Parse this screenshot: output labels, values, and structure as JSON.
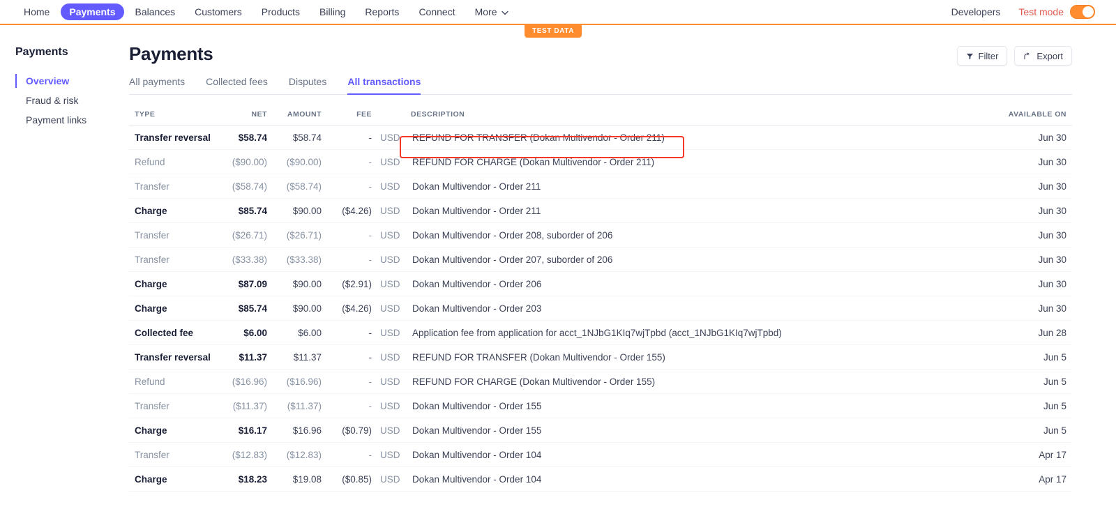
{
  "topnav": {
    "items": [
      {
        "label": "Home",
        "active": false
      },
      {
        "label": "Payments",
        "active": true
      },
      {
        "label": "Balances",
        "active": false
      },
      {
        "label": "Customers",
        "active": false
      },
      {
        "label": "Products",
        "active": false
      },
      {
        "label": "Billing",
        "active": false
      },
      {
        "label": "Reports",
        "active": false
      },
      {
        "label": "Connect",
        "active": false
      }
    ],
    "more_label": "More",
    "developers_label": "Developers",
    "test_mode_label": "Test mode",
    "test_mode_on": true,
    "accent_purple": "#635BFF",
    "accent_orange": "#FF8C2E"
  },
  "test_data_badge": "TEST DATA",
  "sidebar": {
    "title": "Payments",
    "items": [
      {
        "label": "Overview",
        "active": true
      },
      {
        "label": "Fraud & risk",
        "active": false
      },
      {
        "label": "Payment links",
        "active": false
      }
    ]
  },
  "main": {
    "page_title": "Payments",
    "filter_label": "Filter",
    "export_label": "Export",
    "tabs": [
      {
        "label": "All payments",
        "active": false
      },
      {
        "label": "Collected fees",
        "active": false
      },
      {
        "label": "Disputes",
        "active": false
      },
      {
        "label": "All transactions",
        "active": true
      }
    ]
  },
  "table": {
    "headers": {
      "type": "TYPE",
      "net": "NET",
      "amount": "AMOUNT",
      "fee": "FEE",
      "currency": "",
      "description": "DESCRIPTION",
      "available_on": "AVAILABLE ON"
    },
    "rows": [
      {
        "type": "Transfer reversal",
        "net": "$58.74",
        "amount": "$58.74",
        "fee": "-",
        "currency": "USD",
        "description": "REFUND FOR TRANSFER (Dokan Multivendor - Order 211)",
        "available_on": "Jun 30",
        "muted": false,
        "highlighted": true
      },
      {
        "type": "Refund",
        "net": "($90.00)",
        "amount": "($90.00)",
        "fee": "-",
        "currency": "USD",
        "description": "REFUND FOR CHARGE (Dokan Multivendor - Order 211)",
        "available_on": "Jun 30",
        "muted": true,
        "highlighted": false
      },
      {
        "type": "Transfer",
        "net": "($58.74)",
        "amount": "($58.74)",
        "fee": "-",
        "currency": "USD",
        "description": "Dokan Multivendor - Order 211",
        "available_on": "Jun 30",
        "muted": true,
        "highlighted": false
      },
      {
        "type": "Charge",
        "net": "$85.74",
        "amount": "$90.00",
        "fee": "($4.26)",
        "currency": "USD",
        "description": "Dokan Multivendor - Order 211",
        "available_on": "Jun 30",
        "muted": false,
        "highlighted": false
      },
      {
        "type": "Transfer",
        "net": "($26.71)",
        "amount": "($26.71)",
        "fee": "-",
        "currency": "USD",
        "description": "Dokan Multivendor - Order 208, suborder of 206",
        "available_on": "Jun 30",
        "muted": true,
        "highlighted": false
      },
      {
        "type": "Transfer",
        "net": "($33.38)",
        "amount": "($33.38)",
        "fee": "-",
        "currency": "USD",
        "description": "Dokan Multivendor - Order 207, suborder of 206",
        "available_on": "Jun 30",
        "muted": true,
        "highlighted": false
      },
      {
        "type": "Charge",
        "net": "$87.09",
        "amount": "$90.00",
        "fee": "($2.91)",
        "currency": "USD",
        "description": "Dokan Multivendor - Order 206",
        "available_on": "Jun 30",
        "muted": false,
        "highlighted": false
      },
      {
        "type": "Charge",
        "net": "$85.74",
        "amount": "$90.00",
        "fee": "($4.26)",
        "currency": "USD",
        "description": "Dokan Multivendor - Order 203",
        "available_on": "Jun 30",
        "muted": false,
        "highlighted": false
      },
      {
        "type": "Collected fee",
        "net": "$6.00",
        "amount": "$6.00",
        "fee": "-",
        "currency": "USD",
        "description": "Application fee from application for acct_1NJbG1KIq7wjTpbd (acct_1NJbG1KIq7wjTpbd)",
        "available_on": "Jun 28",
        "muted": false,
        "highlighted": false
      },
      {
        "type": "Transfer reversal",
        "net": "$11.37",
        "amount": "$11.37",
        "fee": "-",
        "currency": "USD",
        "description": "REFUND FOR TRANSFER (Dokan Multivendor - Order 155)",
        "available_on": "Jun 5",
        "muted": false,
        "highlighted": false
      },
      {
        "type": "Refund",
        "net": "($16.96)",
        "amount": "($16.96)",
        "fee": "-",
        "currency": "USD",
        "description": "REFUND FOR CHARGE (Dokan Multivendor - Order 155)",
        "available_on": "Jun 5",
        "muted": true,
        "highlighted": false
      },
      {
        "type": "Transfer",
        "net": "($11.37)",
        "amount": "($11.37)",
        "fee": "-",
        "currency": "USD",
        "description": "Dokan Multivendor - Order 155",
        "available_on": "Jun 5",
        "muted": true,
        "highlighted": false
      },
      {
        "type": "Charge",
        "net": "$16.17",
        "amount": "$16.96",
        "fee": "($0.79)",
        "currency": "USD",
        "description": "Dokan Multivendor - Order 155",
        "available_on": "Jun 5",
        "muted": false,
        "highlighted": false
      },
      {
        "type": "Transfer",
        "net": "($12.83)",
        "amount": "($12.83)",
        "fee": "-",
        "currency": "USD",
        "description": "Dokan Multivendor - Order 104",
        "available_on": "Apr 17",
        "muted": true,
        "highlighted": false
      },
      {
        "type": "Charge",
        "net": "$18.23",
        "amount": "$19.08",
        "fee": "($0.85)",
        "currency": "USD",
        "description": "Dokan Multivendor - Order 104",
        "available_on": "Apr 17",
        "muted": false,
        "highlighted": false
      }
    ]
  },
  "annotation": {
    "color": "#F4372A"
  }
}
